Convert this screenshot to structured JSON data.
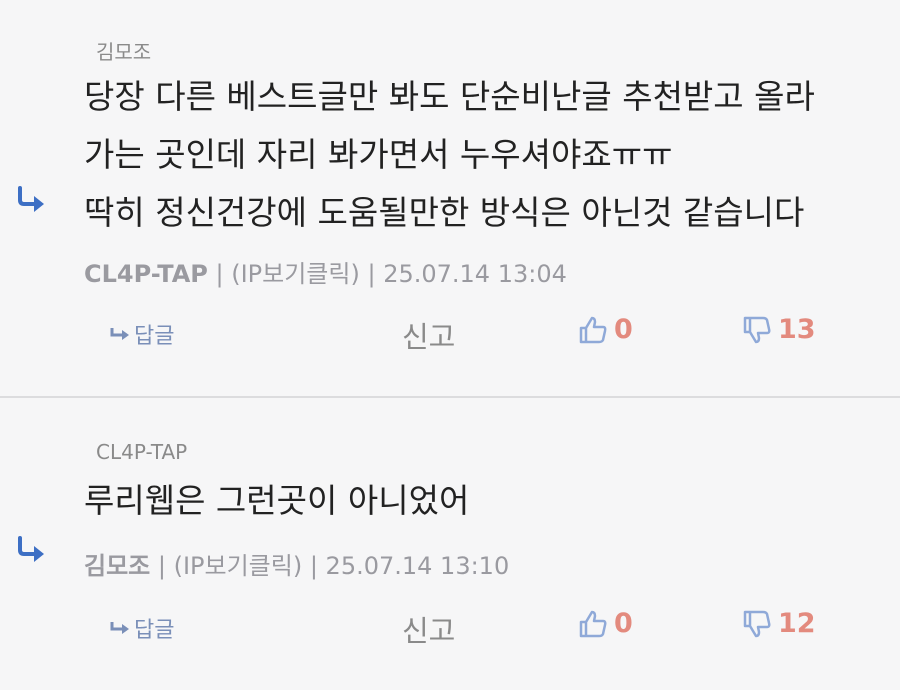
{
  "comments": [
    {
      "parent_author": "김모조",
      "lines": [
        "당장 다른 베스트글만 봐도 단순비난글 추천받고 올라",
        "가는 곳인데 자리 봐가면서 누우셔야죠ㅠㅠ",
        "딱히 정신건강에 도움될만한 방식은 아닌것 같습니다"
      ],
      "author": "CL4P-TAP",
      "ip_note": "(IP보기클릭)",
      "timestamp": "25.07.14 13:04",
      "reply_label": "답글",
      "report_label": "신고",
      "likes": "0",
      "dislikes": "13"
    },
    {
      "parent_author": "CL4P-TAP",
      "lines": [
        "루리웹은 그런곳이 아니었어"
      ],
      "author": "김모조",
      "ip_note": "(IP보기클릭)",
      "timestamp": "25.07.14 13:10",
      "reply_label": "답글",
      "report_label": "신고",
      "likes": "0",
      "dislikes": "12"
    }
  ],
  "colors": {
    "background": "#f6f6f7",
    "text": "#222222",
    "muted": "#9a9aa0",
    "accent_blue": "#3d6fc4",
    "count_red": "#e38a7e",
    "thumb_blue": "#8fa9d8"
  }
}
